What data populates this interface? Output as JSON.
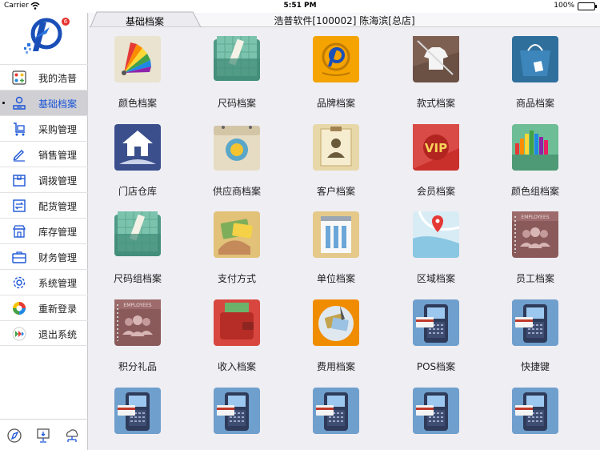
{
  "status_bar": {
    "carrier": "Carrier",
    "time": "5:51 PM",
    "battery": "100%"
  },
  "logo_badge": "6",
  "sidebar": {
    "items": [
      {
        "label": "我的浩普",
        "icon": "apps-icon",
        "active": false
      },
      {
        "label": "基础档案",
        "icon": "user-info-icon",
        "active": true
      },
      {
        "label": "采购管理",
        "icon": "cart-icon",
        "active": false
      },
      {
        "label": "销售管理",
        "icon": "pen-icon",
        "active": false
      },
      {
        "label": "调拨管理",
        "icon": "box-icon",
        "active": false
      },
      {
        "label": "配货管理",
        "icon": "transfer-icon",
        "active": false
      },
      {
        "label": "库存管理",
        "icon": "store-icon",
        "active": false
      },
      {
        "label": "财务管理",
        "icon": "briefcase-icon",
        "active": false
      },
      {
        "label": "系统管理",
        "icon": "gear-icon",
        "active": false
      },
      {
        "label": "重新登录",
        "icon": "color-ring-icon",
        "active": false
      },
      {
        "label": "退出系统",
        "icon": "exit-icon",
        "active": false
      }
    ],
    "bottom_icons": [
      "compass-icon",
      "monitor-icon",
      "cloud-network-icon"
    ]
  },
  "header": {
    "tab": "基础档案",
    "title": "浩普软件[100002] 陈海滨[总店]"
  },
  "grid": [
    {
      "label": "颜色档案",
      "icon": "color-swatch-icon"
    },
    {
      "label": "尺码档案",
      "icon": "ruler-folder-icon"
    },
    {
      "label": "品牌档案",
      "icon": "brand-icon"
    },
    {
      "label": "款式档案",
      "icon": "shirt-icon"
    },
    {
      "label": "商品档案",
      "icon": "shopping-bag-icon"
    },
    {
      "label": "门店仓库",
      "icon": "house-icon"
    },
    {
      "label": "供应商档案",
      "icon": "calendar-coin-icon"
    },
    {
      "label": "客户档案",
      "icon": "clipboard-person-icon"
    },
    {
      "label": "会员档案",
      "icon": "vip-icon"
    },
    {
      "label": "颜色组档案",
      "icon": "color-group-icon"
    },
    {
      "label": "尺码组档案",
      "icon": "ruler-folder-icon"
    },
    {
      "label": "支付方式",
      "icon": "card-payment-icon"
    },
    {
      "label": "单位档案",
      "icon": "building-icon"
    },
    {
      "label": "区域档案",
      "icon": "map-pin-icon"
    },
    {
      "label": "员工档案",
      "icon": "employee-book-icon"
    },
    {
      "label": "积分礼品",
      "icon": "employee-book-icon"
    },
    {
      "label": "收入档案",
      "icon": "wallet-icon"
    },
    {
      "label": "费用档案",
      "icon": "expense-icon"
    },
    {
      "label": "POS档案",
      "icon": "pos-terminal-icon"
    },
    {
      "label": "快捷键",
      "icon": "pos-terminal-icon"
    },
    {
      "label": "",
      "icon": "pos-terminal-icon"
    },
    {
      "label": "",
      "icon": "pos-terminal-icon"
    },
    {
      "label": "",
      "icon": "pos-terminal-icon"
    },
    {
      "label": "",
      "icon": "pos-terminal-icon"
    },
    {
      "label": "",
      "icon": "pos-terminal-icon"
    }
  ]
}
